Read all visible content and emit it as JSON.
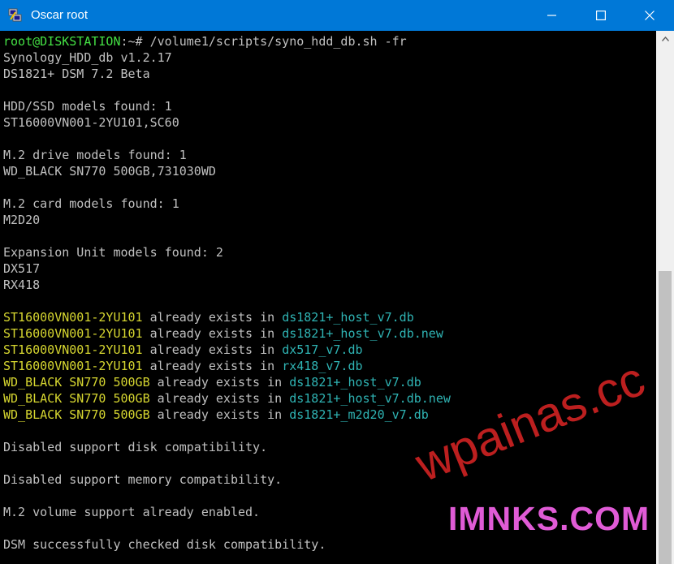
{
  "window": {
    "title": "Oscar root",
    "buttons": {
      "minimize": "—",
      "maximize": "☐",
      "close": "✕"
    }
  },
  "icons": {
    "app": "putty-app-icon",
    "minimize": "minimize-icon",
    "maximize": "maximize-icon",
    "close": "close-icon",
    "scroll_up": "chevron-up-icon"
  },
  "colors": {
    "titlebar": "#0078d7",
    "terminal_bg": "#000000",
    "text_default": "#c0c0c0",
    "prompt_green": "#44e044",
    "model_yellow": "#d6d630",
    "db_cyan": "#2fb4b4"
  },
  "terminal": {
    "prompt": {
      "user_host": "root@DISKSTATION",
      "path_suffix": ":~# ",
      "command": "/volume1/scripts/syno_hdd_db.sh -fr"
    },
    "version": "Synology_HDD_db v1.2.17",
    "model_line": "DS1821+ DSM 7.2 Beta",
    "hdd_header": "HDD/SSD models found: 1",
    "hdd_model": "ST16000VN001-2YU101,SC60",
    "m2_header": "M.2 drive models found: 1",
    "m2_model": "WD_BLACK SN770 500GB,731030WD",
    "card_header": "M.2 card models found: 1",
    "card_model": "M2D20",
    "expansion_header": "Expansion Unit models found: 2",
    "expansion_models": [
      "DX517",
      "RX418"
    ],
    "exists_mid": " already exists in ",
    "exists": [
      {
        "model": "ST16000VN001-2YU101",
        "db": "ds1821+_host_v7.db"
      },
      {
        "model": "ST16000VN001-2YU101",
        "db": "ds1821+_host_v7.db.new"
      },
      {
        "model": "ST16000VN001-2YU101",
        "db": "dx517_v7.db"
      },
      {
        "model": "ST16000VN001-2YU101",
        "db": "rx418_v7.db"
      },
      {
        "model": "WD_BLACK SN770 500GB",
        "db": "ds1821+_host_v7.db"
      },
      {
        "model": "WD_BLACK SN770 500GB",
        "db": "ds1821+_host_v7.db.new"
      },
      {
        "model": "WD_BLACK SN770 500GB",
        "db": "ds1821+_m2d20_v7.db"
      }
    ],
    "msg_disk": "Disabled support disk compatibility.",
    "msg_memory": "Disabled support memory compatibility.",
    "msg_m2_volume": "M.2 volume support already enabled.",
    "msg_success": "DSM successfully checked disk compatibility."
  },
  "watermarks": {
    "script_text": "wpainas.cc",
    "brand_text": "IMNKS.COM"
  }
}
